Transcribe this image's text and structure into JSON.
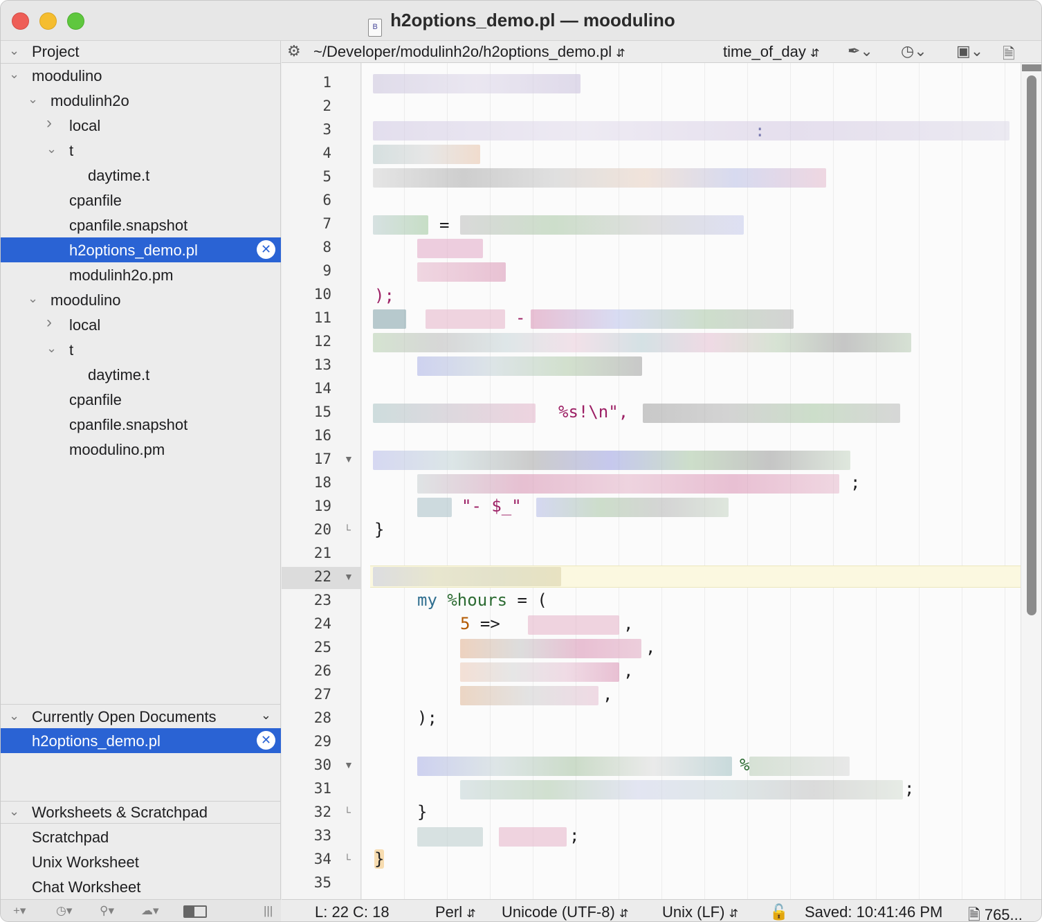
{
  "window": {
    "title": "h2options_demo.pl — moodulino",
    "doc_icon": "B"
  },
  "sidebar": {
    "project_header": "Project",
    "tree": [
      {
        "label": "moodulino",
        "level": 0,
        "chevron": "down"
      },
      {
        "label": "modulinh2o",
        "level": 1,
        "chevron": "down"
      },
      {
        "label": "local",
        "level": 2,
        "chevron": "right"
      },
      {
        "label": "t",
        "level": 2,
        "chevron": "down"
      },
      {
        "label": "daytime.t",
        "level": 3,
        "chevron": ""
      },
      {
        "label": "cpanfile",
        "level": 2,
        "chevron": ""
      },
      {
        "label": "cpanfile.snapshot",
        "level": 2,
        "chevron": ""
      },
      {
        "label": "h2options_demo.pl",
        "level": 2,
        "chevron": "",
        "selected": true
      },
      {
        "label": "modulinh2o.pm",
        "level": 2,
        "chevron": ""
      },
      {
        "label": "moodulino",
        "level": 1,
        "chevron": "down"
      },
      {
        "label": "local",
        "level": 2,
        "chevron": "right"
      },
      {
        "label": "t",
        "level": 2,
        "chevron": "down"
      },
      {
        "label": "daytime.t",
        "level": 3,
        "chevron": ""
      },
      {
        "label": "cpanfile",
        "level": 2,
        "chevron": ""
      },
      {
        "label": "cpanfile.snapshot",
        "level": 2,
        "chevron": ""
      },
      {
        "label": "moodulino.pm",
        "level": 2,
        "chevron": ""
      }
    ],
    "open_docs_header": "Currently Open Documents",
    "open_docs": [
      "h2options_demo.pl"
    ],
    "worksheets_header": "Worksheets & Scratchpad",
    "worksheets": [
      "Scratchpad",
      "Unix Worksheet",
      "Chat Worksheet"
    ]
  },
  "navbar": {
    "path": "~/Developer/modulinh2o/h2options_demo.pl",
    "function": "time_of_day"
  },
  "editor": {
    "line_count": 35,
    "current_line": 22,
    "fold_open_lines": [
      17,
      22,
      30
    ],
    "fold_end_lines": [
      20,
      32,
      34
    ],
    "visible_code": {
      "l3_colon": ":",
      "l7_eq": "=",
      "l10": ");",
      "l11_dash": "-",
      "l15_fmt": "%s!\\n\",",
      "l18_semi": ";",
      "l19_str": "\"- $_\"",
      "l20_brace": "}",
      "l23_my": "my",
      "l23_var": "%hours",
      "l23_rest": " = (",
      "l24_num": "5",
      "l24_arrow": " =>",
      "comma": ",",
      "l28": ");",
      "l30_pct": "%",
      "l31_semi": ";",
      "l32_brace": "}",
      "l33_semi": ";",
      "l34_brace": "}"
    }
  },
  "statusbar": {
    "position": "L: 22 C: 18",
    "language": "Perl",
    "encoding": "Unicode (UTF-8)",
    "line_endings": "Unix (LF)",
    "saved": "Saved: 10:41:46 PM",
    "size": "765..."
  }
}
